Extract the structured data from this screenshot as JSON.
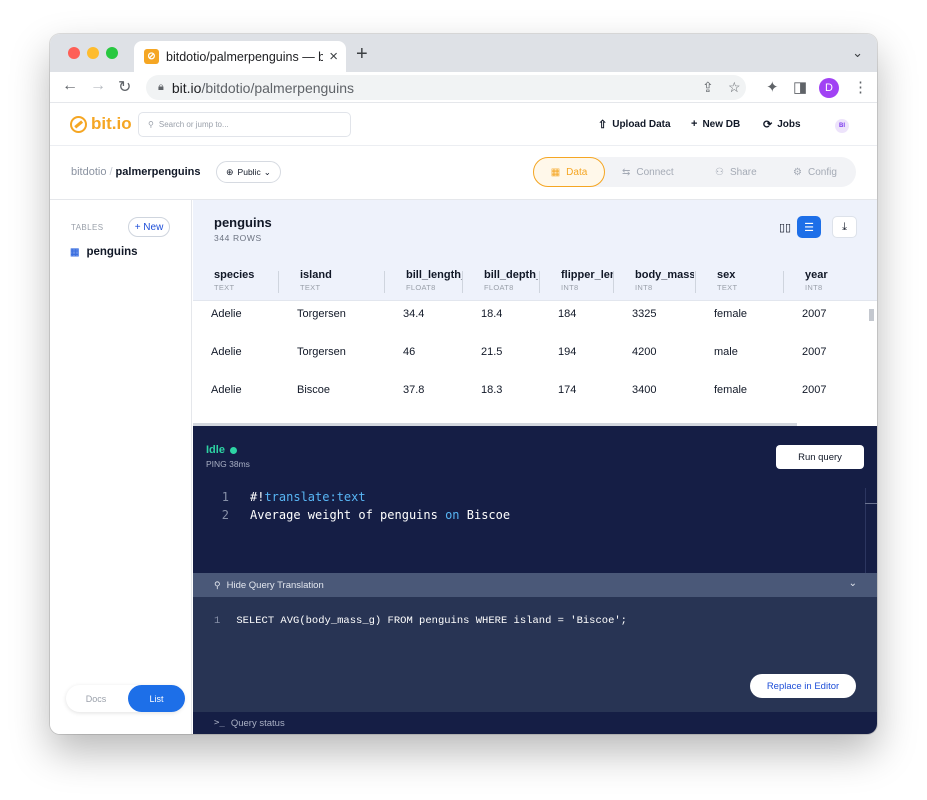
{
  "browser": {
    "tab_title": "bitdotio/palmerpenguins — bit.io",
    "tab_favicon": "⊘",
    "url_host": "bit.io",
    "url_path": "/bitdotio/palmerpenguins",
    "profile_initial": "D"
  },
  "app": {
    "logo_text": "bit.io",
    "search_placeholder": "Search or jump to...",
    "upload_label": "Upload Data",
    "newdb_label": "New DB",
    "jobs_label": "Jobs",
    "user_initials": "BI"
  },
  "repo": {
    "owner": "bitdotio",
    "separator": "/",
    "name": "palmerpenguins",
    "visibility": "Public",
    "tabs": {
      "data": "Data",
      "connect": "Connect",
      "share": "Share",
      "config": "Config"
    }
  },
  "sidebar": {
    "tables_label": "TABLES",
    "new_label": "+ New",
    "table_name": "penguins",
    "docs_label": "Docs",
    "list_label": "List"
  },
  "table": {
    "name": "penguins",
    "rows_label": "344 ROWS",
    "columns": [
      {
        "name": "species",
        "type": "TEXT"
      },
      {
        "name": "island",
        "type": "TEXT"
      },
      {
        "name": "bill_length_mm",
        "type": "FLOAT8"
      },
      {
        "name": "bill_depth_mm",
        "type": "FLOAT8"
      },
      {
        "name": "flipper_length_mm",
        "type": "INT8"
      },
      {
        "name": "body_mass_g",
        "type": "INT8"
      },
      {
        "name": "sex",
        "type": "TEXT"
      },
      {
        "name": "year",
        "type": "INT8"
      }
    ],
    "rows": [
      [
        "Adelie",
        "Torgersen",
        "34.4",
        "18.4",
        "184",
        "3325",
        "female",
        "2007"
      ],
      [
        "Adelie",
        "Torgersen",
        "46",
        "21.5",
        "194",
        "4200",
        "male",
        "2007"
      ],
      [
        "Adelie",
        "Biscoe",
        "37.8",
        "18.3",
        "174",
        "3400",
        "female",
        "2007"
      ]
    ]
  },
  "query": {
    "status": "Idle",
    "ping": "PING 38ms",
    "run_label": "Run query",
    "line1_no": "1",
    "line1_hash": "#!",
    "line1_directive": "translate:text",
    "line2_no": "2",
    "line2_pre": "Average weight of penguins ",
    "line2_kw": "on",
    "line2_post": " Biscoe",
    "translation_toggle": "Hide Query Translation",
    "sql_line_no": "1",
    "sql": "SELECT AVG(body_mass_g) FROM penguins WHERE island = 'Biscoe';",
    "replace_label": "Replace in Editor",
    "status_panel_label": "Query status"
  }
}
